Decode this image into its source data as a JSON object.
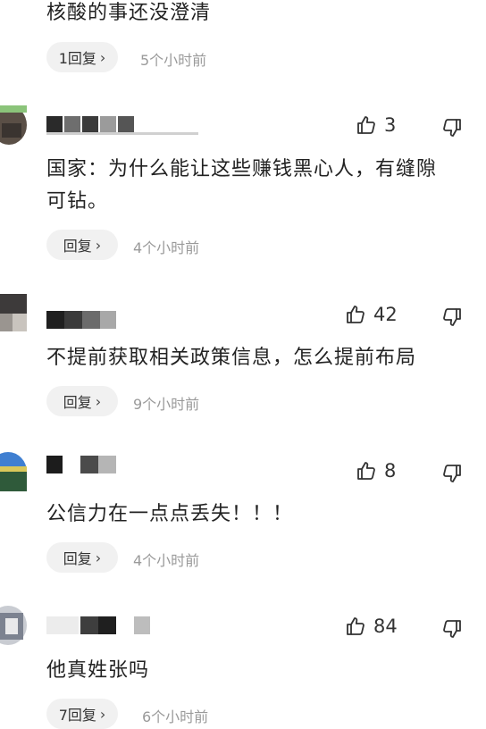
{
  "comments": [
    {
      "text": "核酸的事还没澄清",
      "reply_label": "1回复",
      "time": "5个小时前"
    },
    {
      "text_line1": "国家：为什么能让这些赚钱黑心人，有缝隙",
      "text_line2": "可钻。",
      "likes": "3",
      "reply_label": "回复",
      "time": "4个小时前"
    },
    {
      "text": "不提前获取相关政策信息，怎么提前布局",
      "likes": "42",
      "reply_label": "回复",
      "time": "9个小时前"
    },
    {
      "text": "公信力在一点点丢失！！！",
      "likes": "8",
      "reply_label": "回复",
      "time": "4个小时前"
    },
    {
      "text": "他真姓张吗",
      "likes": "84",
      "reply_label": "7回复",
      "time": "6个小时前"
    }
  ],
  "icons": {
    "like": "thumbs-up-icon",
    "dislike": "thumbs-down-icon",
    "chevron": "chevron-right-icon"
  },
  "colors": {
    "background": "#ffffff",
    "pill": "#f1f1f1",
    "muted": "#9a9a9a"
  }
}
